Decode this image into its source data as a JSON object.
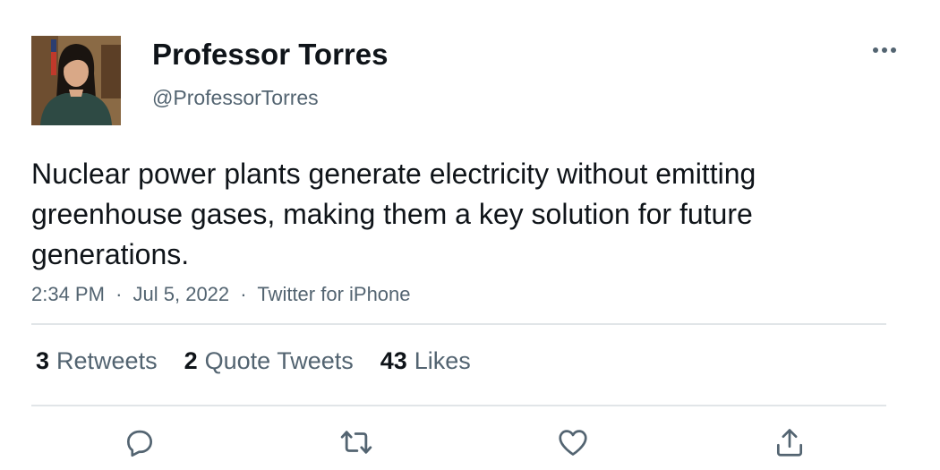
{
  "author": {
    "display_name": "Professor Torres",
    "handle": "@ProfessorTorres",
    "avatar_icon": "profile-photo"
  },
  "tweet": {
    "text": "Nuclear power plants generate electricity without emitting greenhouse gases, making them a key solution for future generations.",
    "time": "2:34 PM",
    "date": "Jul 5, 2022",
    "source": "Twitter for iPhone",
    "separator": "·"
  },
  "stats": {
    "retweets_count": "3",
    "retweets_label": "Retweets",
    "quotes_count": "2",
    "quotes_label": "Quote Tweets",
    "likes_count": "43",
    "likes_label": "Likes"
  },
  "actions": [
    "reply-icon",
    "retweet-icon",
    "like-icon",
    "share-icon"
  ],
  "colors": {
    "text": "#0f1419",
    "secondary": "#536471",
    "divider": "#e1e5e8"
  }
}
